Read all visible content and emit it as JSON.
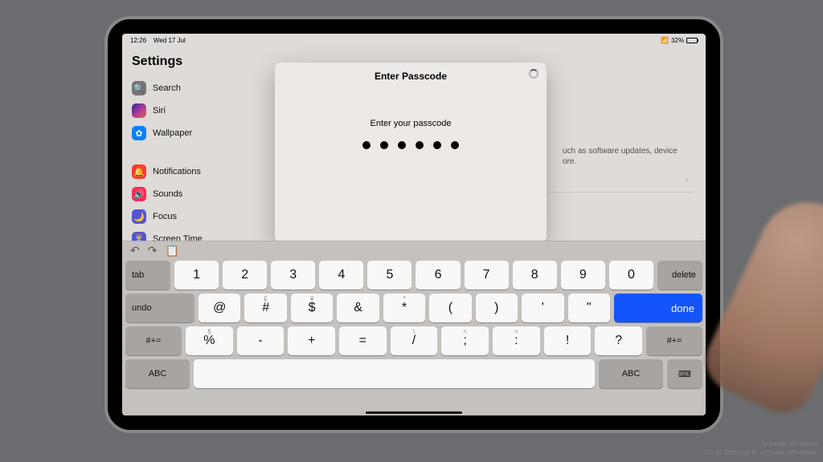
{
  "status": {
    "time": "12:26",
    "date": "Wed 17 Jul",
    "battery": "32%"
  },
  "sidebar": {
    "title": "Settings",
    "items": [
      {
        "label": "Search"
      },
      {
        "label": "Siri"
      },
      {
        "label": "Wallpaper"
      },
      {
        "label": "Notifications"
      },
      {
        "label": "Sounds"
      },
      {
        "label": "Focus"
      },
      {
        "label": "Screen Time"
      }
    ]
  },
  "main": {
    "hint_fragment": "uch as software updates, device",
    "hint_fragment2": "ore."
  },
  "modal": {
    "title": "Enter Passcode",
    "subtitle": "Enter your passcode",
    "filled_dots": 6
  },
  "keyboard": {
    "row1": [
      "1",
      "2",
      "3",
      "4",
      "5",
      "6",
      "7",
      "8",
      "9",
      "0"
    ],
    "tab": "tab",
    "delete": "delete",
    "row2": [
      {
        "k": "@",
        "a": ""
      },
      {
        "k": "#",
        "a": "£"
      },
      {
        "k": "$",
        "a": "¥"
      },
      {
        "k": "&",
        "a": ""
      },
      {
        "k": "*",
        "a": "^"
      },
      {
        "k": "(",
        "a": ""
      },
      {
        "k": ")",
        "a": ""
      },
      {
        "k": "'",
        "a": ""
      },
      {
        "k": "\"",
        "a": ""
      }
    ],
    "undo": "undo",
    "done": "done",
    "row3": [
      {
        "k": "%",
        "a": "§"
      },
      {
        "k": "-",
        "a": ""
      },
      {
        "k": "+",
        "a": ""
      },
      {
        "k": "=",
        "a": ""
      },
      {
        "k": "/",
        "a": "\\"
      },
      {
        "k": ";",
        "a": "<"
      },
      {
        "k": ":",
        "a": ">"
      },
      {
        "k": "!",
        "a": ""
      },
      {
        "k": "?",
        "a": ""
      }
    ],
    "sym": "#+=",
    "abc": "ABC"
  },
  "watermark": {
    "l1": "Activate Windows",
    "l2": "Go to Settings to activate Windows."
  }
}
